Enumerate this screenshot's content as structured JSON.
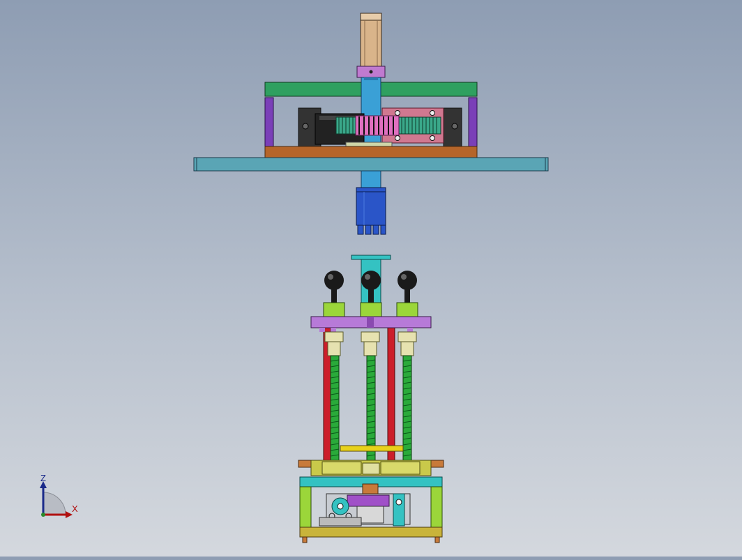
{
  "viewport": {
    "background_top": "#8e9db3",
    "background_bottom": "#d4d8de"
  },
  "triad": {
    "z_label": "Z",
    "x_label": "X",
    "z_color": "#1a2a8a",
    "x_color": "#b01010"
  },
  "colors": {
    "green_plate": "#2fa060",
    "purple_post": "#7a3fb8",
    "brown_base": "#b5652a",
    "teal_plate": "#5aa5b5",
    "blue_shaft": "#3aa0d6",
    "blue_gripper": "#2a55c8",
    "cylinder_tan": "#d9b48a",
    "rack_green": "#3aa88a",
    "rack_pink": "#e070c0",
    "slide_red": "#d07890",
    "red_rod": "#cc1e2a",
    "screw_green": "#2aaa3a",
    "knob_black": "#1a1a1a",
    "collar_green": "#9bd63a",
    "violet_bar": "#b77ad8",
    "olive_block": "#c9c94a",
    "yellow_pin": "#e8d21a",
    "base_olive": "#c9b43a",
    "cyan_block": "#34c2c2"
  }
}
